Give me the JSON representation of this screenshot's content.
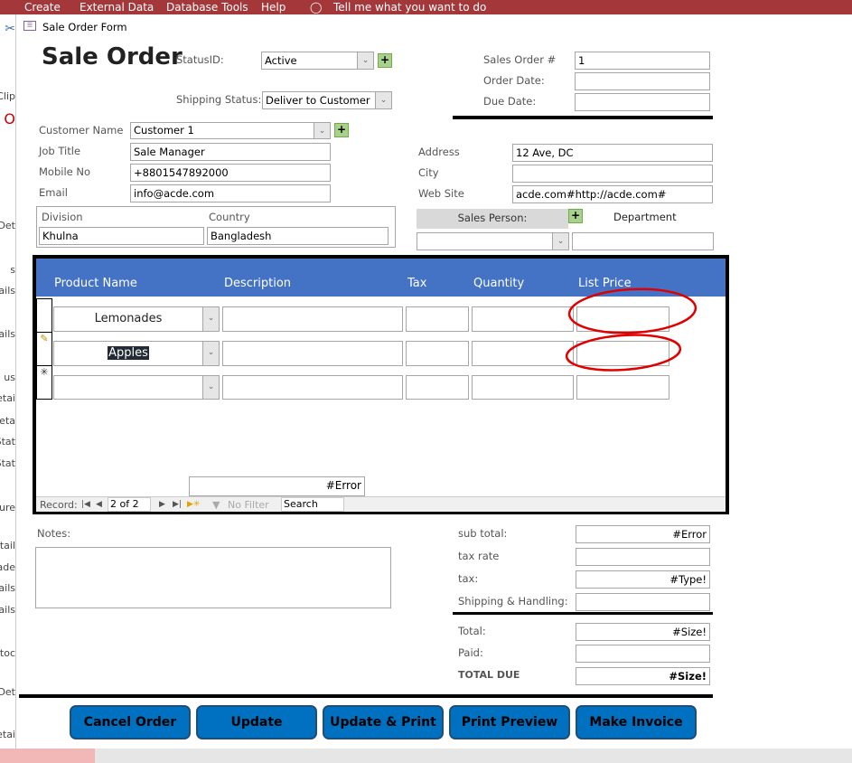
{
  "ribbon": {
    "tabs": [
      "Create",
      "External Data",
      "Database Tools",
      "Help"
    ],
    "tell_me": "Tell me what you want to do"
  },
  "left_pane": {
    "fragments": [
      "Clip",
      "Det",
      "s",
      "tails",
      "ails",
      "us",
      "etai",
      "Deta",
      "Stat",
      "Stat",
      "ure",
      "etail",
      "eade",
      "ails",
      "ails",
      "Stoc",
      "rDet",
      "etai"
    ]
  },
  "window": {
    "title": "Sale Order Form"
  },
  "header": {
    "title": "Sale Order",
    "status_label": "StatusID:",
    "status_value": "Active",
    "shipping_label": "Shipping Status:",
    "shipping_value": "Deliver to Customer",
    "sales_order_label": "Sales Order #",
    "sales_order_value": "1",
    "order_date_label": "Order Date:",
    "order_date_value": "",
    "due_date_label": "Due Date:",
    "due_date_value": ""
  },
  "customer": {
    "name_label": "Customer Name",
    "name_value": "Customer 1",
    "job_label": "Job Title",
    "job_value": "Sale Manager",
    "mobile_label": "Mobile No",
    "mobile_value": "+8801547892000",
    "email_label": "Email",
    "email_value": "info@acde.com",
    "division_label": "Division",
    "division_value": "Khulna",
    "country_label": "Country",
    "country_value": "Bangladesh",
    "address_label": "Address",
    "address_value": "12 Ave, DC",
    "city_label": "City",
    "city_value": "",
    "website_label": "Web Site",
    "website_value": "acde.com#http://acde.com#",
    "sales_person_label": "Sales Person:",
    "sales_person_value": "",
    "department_label": "Department",
    "department_value": ""
  },
  "subform": {
    "columns": [
      "Product Name",
      "Description",
      "Tax",
      "Quantity",
      "List Price"
    ],
    "rows": [
      {
        "product": "Lemonades",
        "description": "",
        "tax": "",
        "quantity": "",
        "list_price": ""
      },
      {
        "product": "Apples",
        "description": "",
        "tax": "",
        "quantity": "",
        "list_price": ""
      },
      {
        "product": "",
        "description": "",
        "tax": "",
        "quantity": "",
        "list_price": ""
      }
    ],
    "footer_value": "#Error",
    "nav": {
      "record_label": "Record:",
      "position": "2 of 2",
      "filter": "No Filter",
      "search": "Search"
    }
  },
  "notes": {
    "label": "Notes:",
    "value": ""
  },
  "totals": {
    "subtotal_label": "sub total:",
    "subtotal": "#Error",
    "taxrate_label": "tax rate",
    "taxrate": "",
    "tax_label": "tax:",
    "tax": "#Type!",
    "shipping_label": "Shipping & Handling:",
    "shipping": "",
    "total_label": "Total:",
    "total": "#Size!",
    "paid_label": "Paid:",
    "paid": "",
    "due_label": "TOTAL DUE",
    "due": "#Size!"
  },
  "buttons": [
    "Cancel Order",
    "Update",
    "Update & Print",
    "Print Preview",
    "Make Invoice"
  ],
  "colors": {
    "ribbon": "#a4373a",
    "header_blue": "#4472c4",
    "button_blue": "#0070c0",
    "annotation": "#e00000"
  }
}
